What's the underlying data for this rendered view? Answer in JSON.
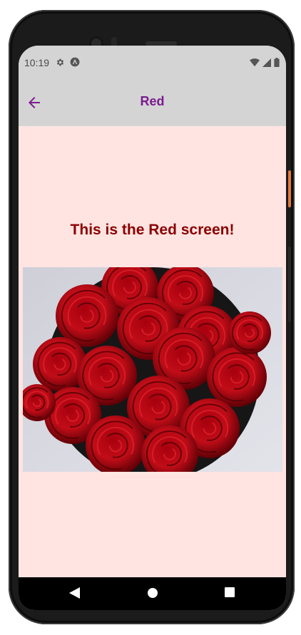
{
  "status_bar": {
    "time": "10:19",
    "left_icons": [
      "gear-icon",
      "app-notification-icon"
    ],
    "right_icons": [
      "wifi-icon",
      "signal-icon",
      "battery-icon"
    ]
  },
  "app_bar": {
    "title": "Red",
    "back_icon": "arrow-left-icon",
    "background": "#d4d4d4",
    "accent": "#7b1b8f"
  },
  "content": {
    "heading": "This is the Red screen!",
    "heading_color": "#8b0000",
    "background": "#ffe4e1",
    "image_subject": "bouquet of red roses in a round box"
  },
  "nav_bar": {
    "buttons": [
      "back-triangle-icon",
      "home-circle-icon",
      "recents-square-icon"
    ]
  }
}
